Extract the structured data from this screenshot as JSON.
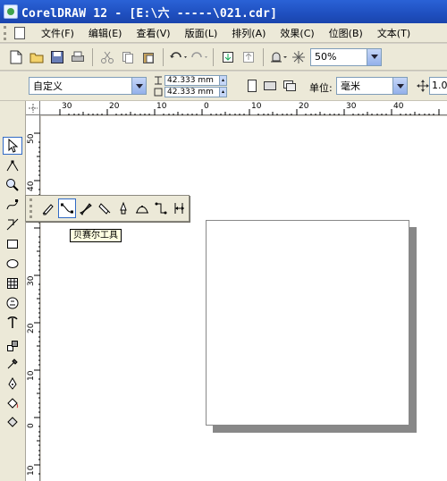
{
  "window": {
    "title": "CorelDRAW 12 - [E:\\六   -----\\021.cdr]"
  },
  "menu": {
    "items": [
      "文件(F)",
      "编辑(E)",
      "查看(V)",
      "版面(L)",
      "排列(A)",
      "效果(C)",
      "位图(B)",
      "文本(T)"
    ]
  },
  "toolbar": {
    "zoom_value": "50%"
  },
  "property_bar": {
    "page_size": "自定义",
    "width": "42.333 mm",
    "height": "42.333 mm",
    "units_label": "单位:",
    "units_value": "毫米",
    "nudge_value": "1.0"
  },
  "rulers": {
    "top_ticks": [
      "30",
      "20",
      "10",
      "0",
      "10",
      "20",
      "30",
      "40"
    ],
    "left_ticks": [
      "50",
      "40",
      "30",
      "20",
      "10",
      "0",
      "10"
    ]
  },
  "tooltip": {
    "text": "贝赛尔工具"
  }
}
